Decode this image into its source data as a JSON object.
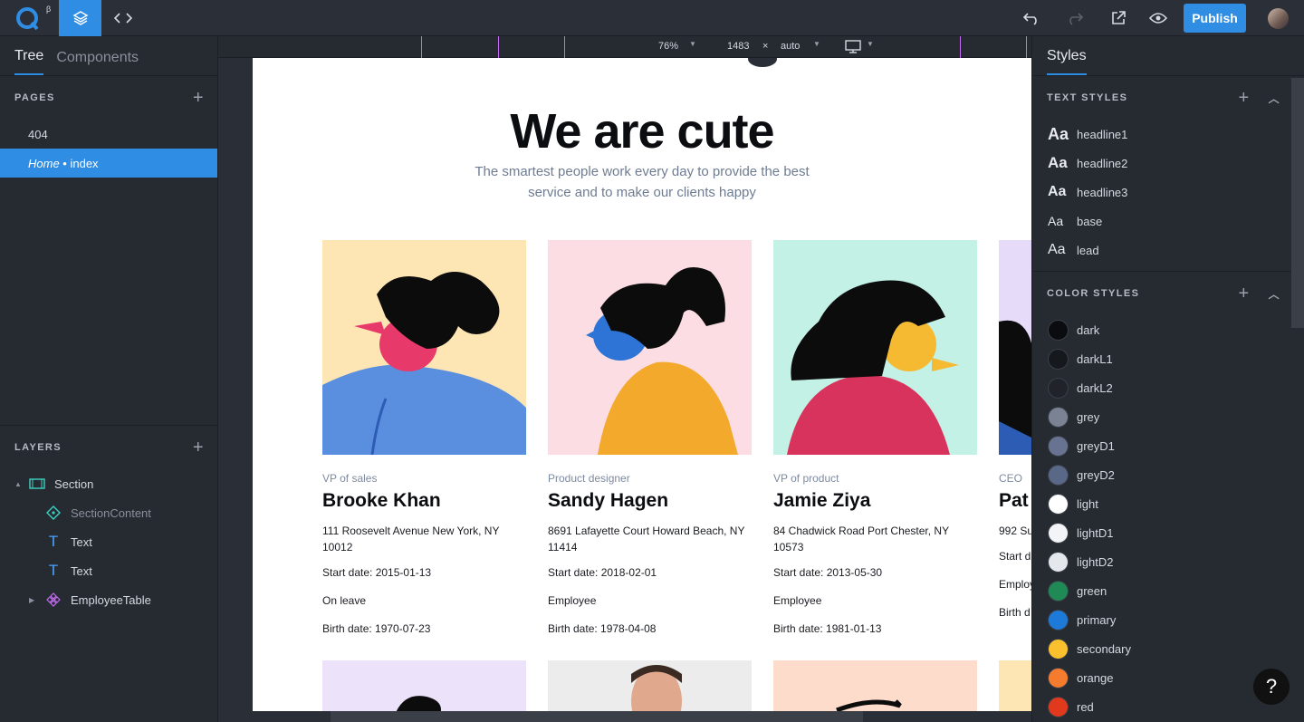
{
  "topbar": {
    "logo_badge": "β",
    "publish_label": "Publish"
  },
  "left": {
    "tabs": [
      {
        "label": "Tree"
      },
      {
        "label": "Components"
      }
    ],
    "pages_header": "PAGES",
    "pages": [
      {
        "label": "404"
      },
      {
        "prefix": "Home",
        "sep": " • ",
        "label": "index"
      }
    ],
    "layers_header": "LAYERS",
    "layers": [
      {
        "label": "Section",
        "icon": "section-icon"
      },
      {
        "label": "SectionContent",
        "icon": "component-diamond-icon"
      },
      {
        "label": "Text",
        "icon": "text-icon"
      },
      {
        "label": "Text",
        "icon": "text-icon"
      },
      {
        "label": "EmployeeTable",
        "icon": "component-instance-icon"
      }
    ]
  },
  "toolbar": {
    "zoom": "76%",
    "width": "1483",
    "times": "×",
    "height": "auto",
    "device": "desktop-icon"
  },
  "page": {
    "title": "We are cute",
    "subtitle": "The smartest people work every day to provide the best service and to make our clients happy",
    "employees": [
      {
        "role": "VP of sales",
        "name": "Brooke Khan",
        "address": "111 Roosevelt Avenue New York, NY 10012",
        "start": "Start date: 2015-01-13",
        "status": "On leave",
        "birth": "Birth date: 1970-07-23",
        "bg": "#fde6b3"
      },
      {
        "role": "Product designer",
        "name": "Sandy Hagen",
        "address": "8691 Lafayette Court Howard Beach, NY 11414",
        "start": "Start date: 2018-02-01",
        "status": "Employee",
        "birth": "Birth date: 1978-04-08",
        "bg": "#fcdde4"
      },
      {
        "role": "VP of product",
        "name": "Jamie Ziya",
        "address": "84 Chadwick Road Port Chester, NY 10573",
        "start": "Start date: 2013-05-30",
        "status": "Employee",
        "birth": "Birth date: 1981-01-13",
        "bg": "#c4f1e6"
      },
      {
        "role": "CEO",
        "name": "Pat",
        "address": "992 Su",
        "start": "Start d",
        "status": "Employ",
        "birth": "Birth d",
        "bg": "#e6dcfa"
      }
    ]
  },
  "right": {
    "tab": "Styles",
    "text_styles_header": "TEXT STYLES",
    "text_styles": [
      {
        "icon": "Aa",
        "label": "headline1",
        "size": "18px",
        "weight": "bold"
      },
      {
        "icon": "Aa",
        "label": "headline2",
        "size": "17px",
        "weight": "bold"
      },
      {
        "icon": "Aa",
        "label": "headline3",
        "size": "16px",
        "weight": "bold"
      },
      {
        "icon": "Aa",
        "label": "base",
        "size": "14px",
        "weight": "normal"
      },
      {
        "icon": "Aa",
        "label": "lead",
        "size": "16px",
        "weight": "normal"
      }
    ],
    "color_styles_header": "COLOR STYLES",
    "color_styles": [
      {
        "label": "dark",
        "color": "#0b0c0f"
      },
      {
        "label": "darkL1",
        "color": "#15181d"
      },
      {
        "label": "darkL2",
        "color": "#20242a"
      },
      {
        "label": "grey",
        "color": "#7a8294"
      },
      {
        "label": "greyD1",
        "color": "#687391"
      },
      {
        "label": "greyD2",
        "color": "#5a6888"
      },
      {
        "label": "light",
        "color": "#ffffff"
      },
      {
        "label": "lightD1",
        "color": "#f3f4f7"
      },
      {
        "label": "lightD2",
        "color": "#e4e7ec"
      },
      {
        "label": "green",
        "color": "#1f8a56"
      },
      {
        "label": "primary",
        "color": "#1e7ad8"
      },
      {
        "label": "secondary",
        "color": "#fbc02d"
      },
      {
        "label": "orange",
        "color": "#f57c2e"
      },
      {
        "label": "red",
        "color": "#e0391c"
      }
    ]
  },
  "help_label": "?"
}
